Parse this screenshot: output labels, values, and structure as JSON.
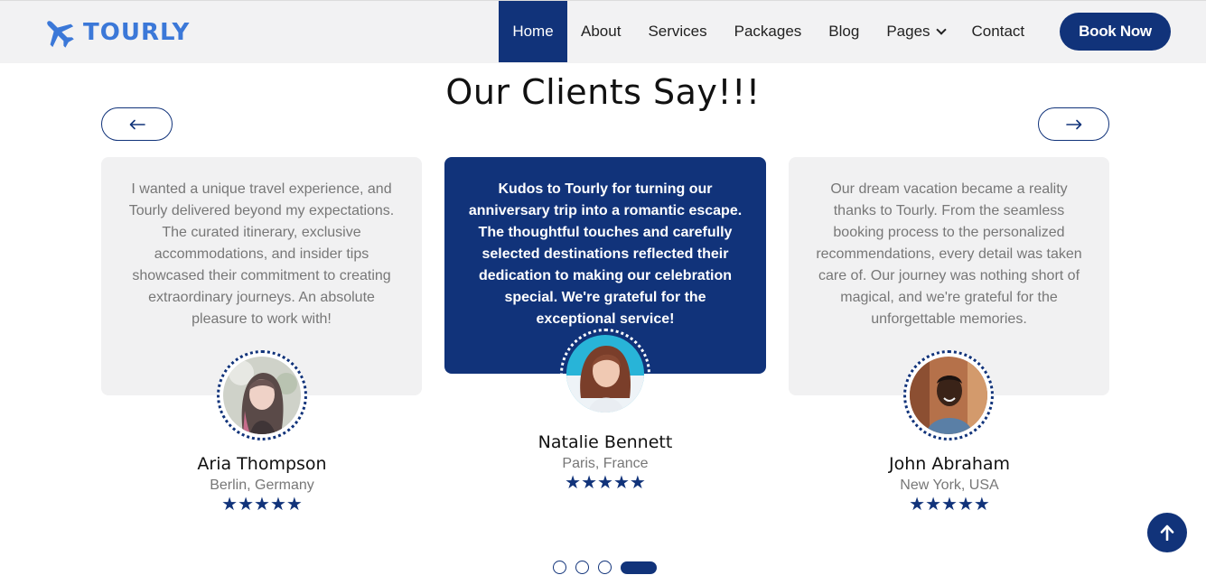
{
  "brand": {
    "name": "TOURLY",
    "icon": "airplane-icon",
    "color": "#3b78d8"
  },
  "nav": {
    "items": [
      {
        "label": "Home",
        "active": true
      },
      {
        "label": "About"
      },
      {
        "label": "Services"
      },
      {
        "label": "Packages"
      },
      {
        "label": "Blog"
      },
      {
        "label": "Pages",
        "has_dropdown": true
      },
      {
        "label": "Contact"
      }
    ],
    "cta": "Book Now"
  },
  "section": {
    "title": "Our Clients Say!!!"
  },
  "testimonials": [
    {
      "text": "I wanted a unique travel experience, and Tourly delivered beyond my expectations. The curated itinerary, exclusive accommodations, and insider tips showcased their commitment to creating extraordinary journeys. An absolute pleasure to work with!",
      "name": "Aria Thompson",
      "location": "Berlin, Germany",
      "stars": "★★★★★",
      "rating": 5
    },
    {
      "text": "Kudos to Tourly for turning our anniversary trip into a romantic escape. The thoughtful touches and carefully selected destinations reflected their dedication to making our celebration special. We're grateful for the exceptional service!",
      "name": "Natalie Bennett",
      "location": "Paris, France",
      "stars": "★★★★★",
      "rating": 5,
      "featured": true
    },
    {
      "text": "Our dream vacation became a reality thanks to Tourly. From the seamless booking process to the personalized recommendations, every detail was taken care of. Our journey was nothing short of magical, and we're grateful for the unforgettable memories.",
      "name": "John Abraham",
      "location": "New York, USA",
      "stars": "★★★★★",
      "rating": 5
    }
  ],
  "carousel": {
    "total_pages": 4,
    "active_page": 4
  },
  "colors": {
    "primary": "#11337a",
    "card_bg": "#f1f1f2",
    "header_bg": "#f2f2f3"
  }
}
